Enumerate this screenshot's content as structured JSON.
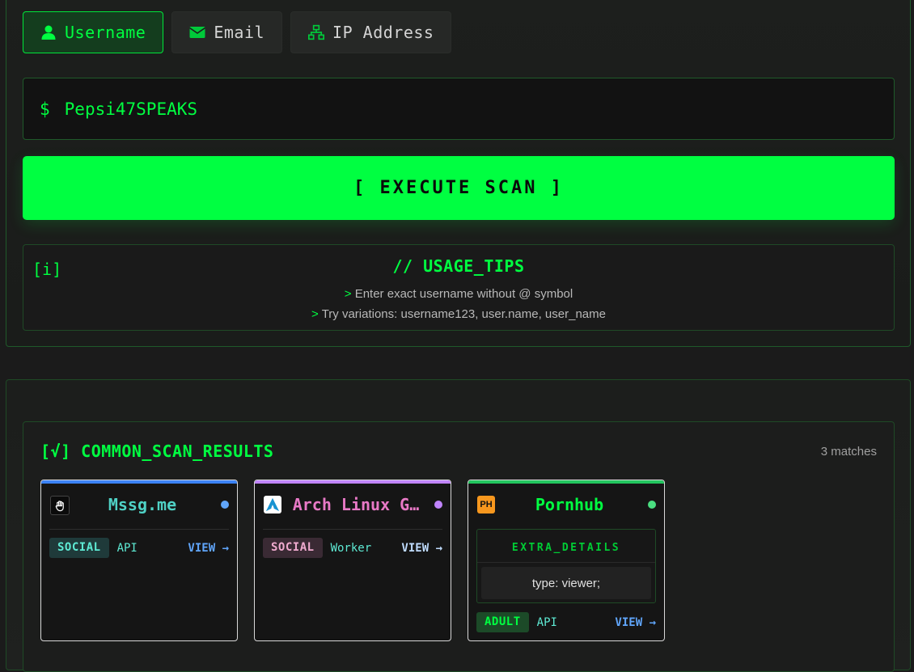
{
  "tabs": [
    {
      "label": "Username",
      "icon": "user-icon",
      "active": true
    },
    {
      "label": "Email",
      "icon": "envelope-icon",
      "active": false
    },
    {
      "label": "IP Address",
      "icon": "network-icon",
      "active": false
    }
  ],
  "search": {
    "prompt": "$",
    "value": "Pepsi47SPEAKS"
  },
  "execute_label": "[ EXECUTE SCAN ]",
  "tips": {
    "info_marker": "[i]",
    "title": "// USAGE_TIPS",
    "prefix": ">",
    "lines": [
      "Enter exact username without @ symbol",
      "Try variations: username123, user.name, user_name"
    ]
  },
  "results": {
    "title": "[√] COMMON_SCAN_RESULTS",
    "count": "3 matches",
    "cards": [
      {
        "name": "Mssg.me",
        "favicon": "hand-icon",
        "tag": "SOCIAL",
        "source": "API",
        "view": "VIEW →",
        "accent": "#3b82f6",
        "name_color": "#4fd1c5",
        "dot": "#60a5fa",
        "tag_bg": "#1f3a3a",
        "tag_color": "#5eead4",
        "source_color": "#5eead4",
        "view_color": "#60a5fa"
      },
      {
        "name": "Arch Linux G…",
        "favicon": "arch-linux-icon",
        "tag": "SOCIAL",
        "source": "Worker",
        "view": "VIEW →",
        "accent": "#c084fc",
        "name_color": "#e879c6",
        "dot": "#c084fc",
        "tag_bg": "#3a2a34",
        "tag_color": "#f0abcf",
        "source_color": "#5eead4",
        "view_color": "#bfdbfe"
      },
      {
        "name": "Pornhub",
        "favicon_text": "PH",
        "favicon": "pornhub-icon",
        "tag": "ADULT",
        "source": "API",
        "view": "VIEW →",
        "accent": "#22c55e",
        "name_color": "#00ff41",
        "dot": "#4ade80",
        "tag_bg": "#1c4a28",
        "tag_color": "#00ff41",
        "source_color": "#5eead4",
        "view_color": "#60a5fa",
        "extra": {
          "heading": "EXTRA_DETAILS",
          "body": "type: viewer;"
        }
      }
    ]
  }
}
